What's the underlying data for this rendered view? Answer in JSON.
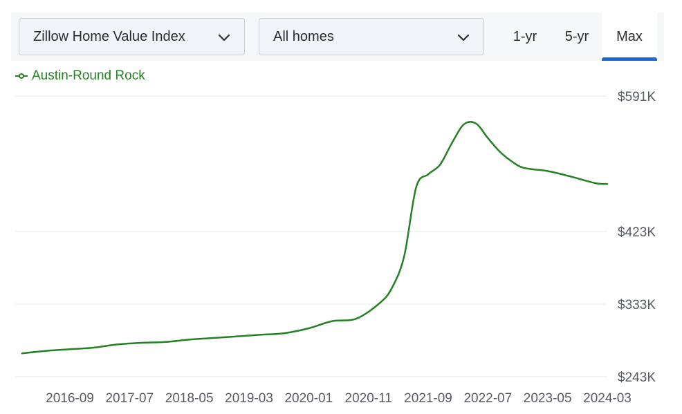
{
  "controls": {
    "metric_select": "Zillow Home Value Index",
    "home_type_select": "All homes",
    "ranges": [
      {
        "label": "1-yr",
        "active": false
      },
      {
        "label": "5-yr",
        "active": false
      },
      {
        "label": "Max",
        "active": true
      }
    ]
  },
  "colors": {
    "series": "#238023",
    "active_tab": "#1b6bdb",
    "grid": "#e9e9ee"
  },
  "chart_data": {
    "type": "line",
    "title": "",
    "xlabel": "",
    "ylabel": "",
    "legend_position": "top-left",
    "grid": true,
    "y_ticks": [
      {
        "value": 591,
        "label": "$591K"
      },
      {
        "value": 423,
        "label": "$423K"
      },
      {
        "value": 333,
        "label": "$333K"
      },
      {
        "value": 243,
        "label": "$243K"
      }
    ],
    "x_ticks": [
      "2016-09",
      "2017-07",
      "2018-05",
      "2019-03",
      "2020-01",
      "2020-11",
      "2021-09",
      "2022-07",
      "2023-05",
      "2024-03"
    ],
    "series": [
      {
        "name": "Austin-Round Rock",
        "color": "#238023",
        "points": [
          [
            "2016-01",
            272
          ],
          [
            "2016-05",
            275
          ],
          [
            "2016-09",
            277
          ],
          [
            "2017-01",
            279
          ],
          [
            "2017-05",
            283
          ],
          [
            "2017-09",
            285
          ],
          [
            "2018-01",
            286
          ],
          [
            "2018-05",
            289
          ],
          [
            "2018-09",
            291
          ],
          [
            "2019-01",
            293
          ],
          [
            "2019-05",
            295
          ],
          [
            "2019-09",
            297
          ],
          [
            "2020-01",
            303
          ],
          [
            "2020-05",
            312
          ],
          [
            "2020-09",
            315
          ],
          [
            "2021-01",
            335
          ],
          [
            "2021-03",
            354
          ],
          [
            "2021-05",
            393
          ],
          [
            "2021-07",
            478
          ],
          [
            "2021-09",
            494
          ],
          [
            "2021-11",
            506
          ],
          [
            "2022-01",
            533
          ],
          [
            "2022-03",
            556
          ],
          [
            "2022-05",
            557
          ],
          [
            "2022-07",
            539
          ],
          [
            "2022-09",
            522
          ],
          [
            "2022-11",
            510
          ],
          [
            "2023-01",
            502
          ],
          [
            "2023-05",
            498
          ],
          [
            "2023-09",
            491
          ],
          [
            "2024-01",
            483
          ],
          [
            "2024-03",
            482
          ]
        ]
      }
    ]
  }
}
